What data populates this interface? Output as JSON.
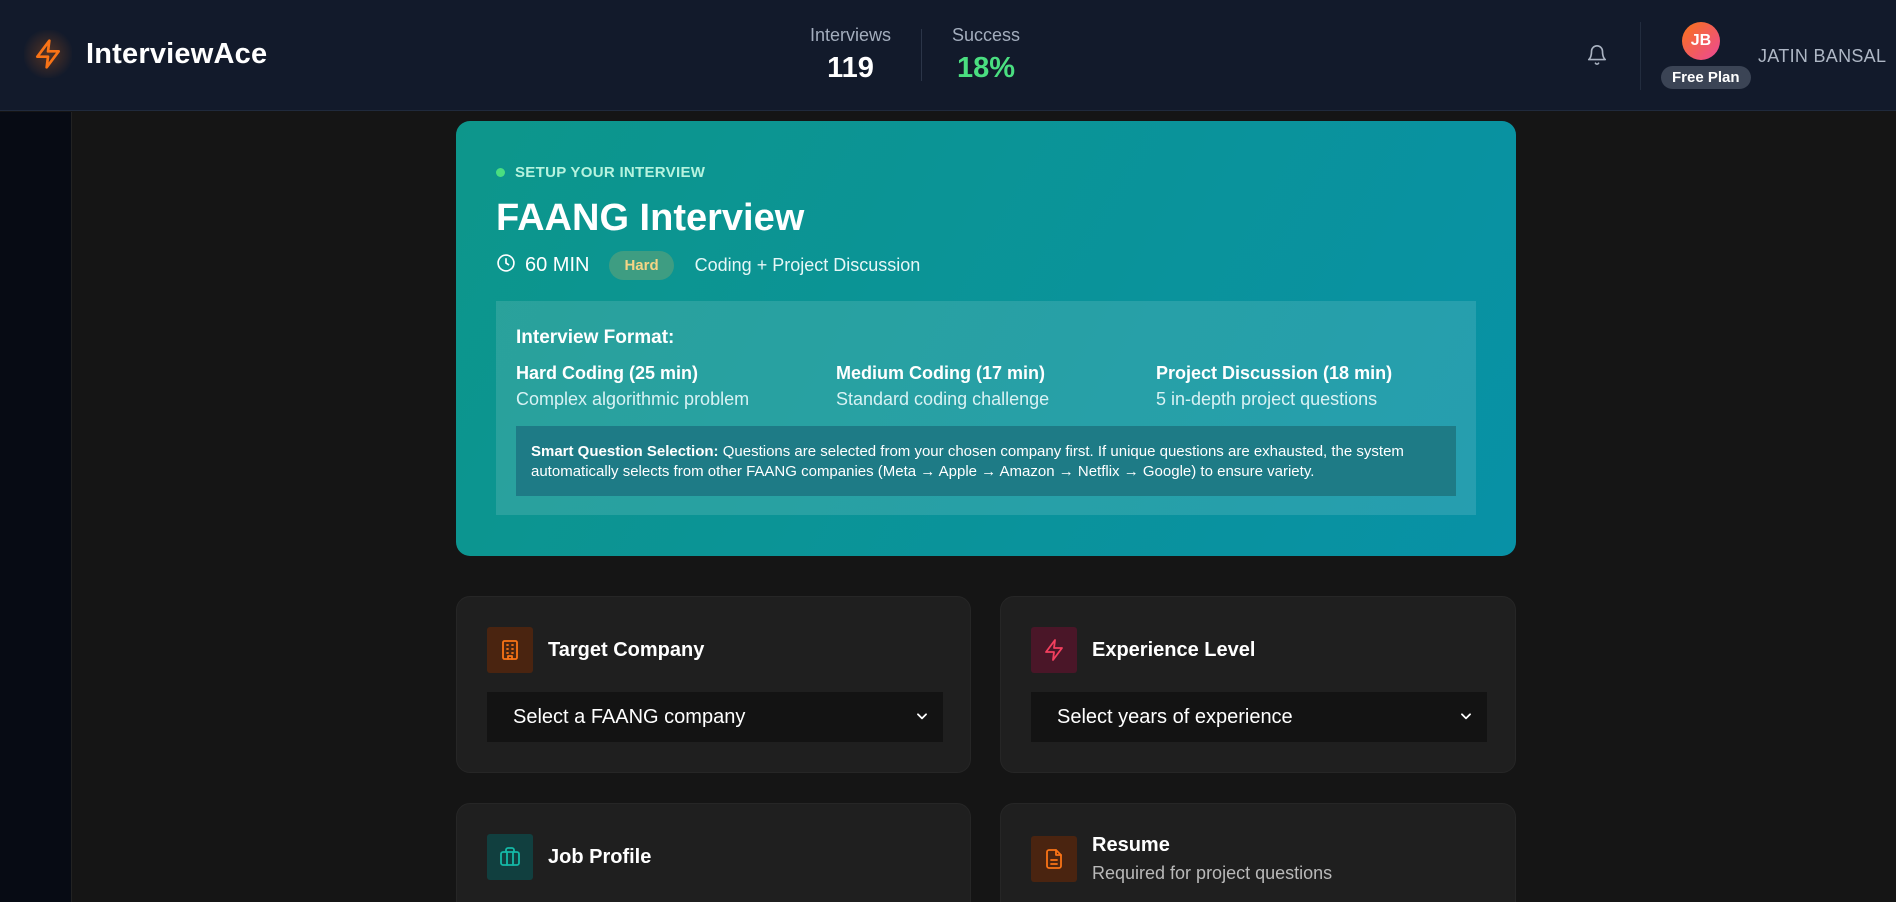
{
  "app": {
    "name": "InterviewAce"
  },
  "header": {
    "stats": [
      {
        "label": "Interviews",
        "value": "119"
      },
      {
        "label": "Success",
        "value": "18%"
      }
    ],
    "user": {
      "initials": "JB",
      "plan": "Free Plan",
      "name": "JATIN BANSAL"
    }
  },
  "hero": {
    "tag": "SETUP YOUR INTERVIEW",
    "title": "FAANG Interview",
    "duration": "60 MIN",
    "difficulty": "Hard",
    "subtitle": "Coding + Project Discussion",
    "format": {
      "title": "Interview Format:",
      "columns": [
        {
          "title": "Hard Coding (25 min)",
          "desc": "Complex algorithmic problem"
        },
        {
          "title": "Medium Coding (17 min)",
          "desc": "Standard coding challenge"
        },
        {
          "title": "Project Discussion (18 min)",
          "desc": "5 in-depth project questions"
        }
      ],
      "smart_label": "Smart Question Selection:",
      "smart_text": " Questions are selected from your chosen company first. If unique questions are exhausted, the system automatically selects from other FAANG companies (Meta → Apple → Amazon → Netflix → Google) to ensure variety."
    }
  },
  "form": {
    "company": {
      "title": "Target Company",
      "placeholder": "Select a FAANG company"
    },
    "experience": {
      "title": "Experience Level",
      "placeholder": "Select years of experience"
    },
    "job_profile": {
      "title": "Job Profile"
    },
    "resume": {
      "title": "Resume",
      "subtitle": "Required for project questions"
    }
  },
  "colors": {
    "accent_orange": "#f97316",
    "accent_pink": "#ec4899",
    "success_green": "#4ade80",
    "teal": "#0d968b"
  },
  "icons": [
    "bolt-icon",
    "bell-icon",
    "clock-icon",
    "building-icon",
    "bolt-icon",
    "briefcase-icon",
    "document-icon",
    "chevron-down-icon"
  ]
}
